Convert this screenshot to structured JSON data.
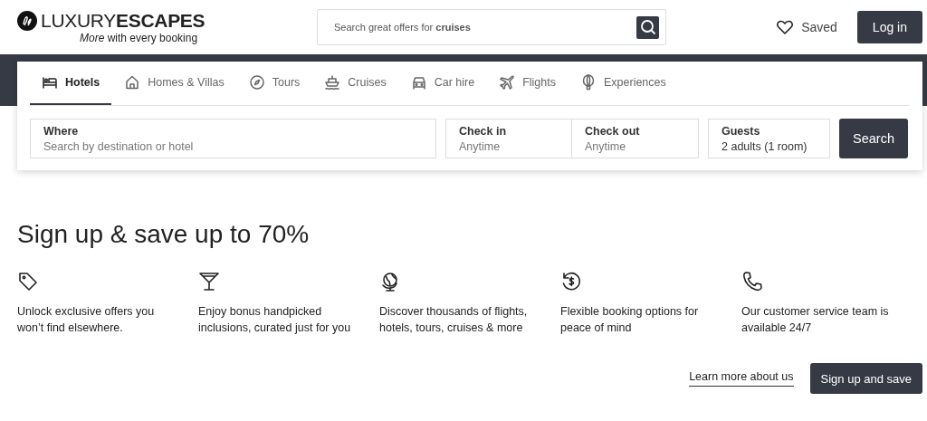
{
  "header": {
    "logo": {
      "brand_light": "LUXURY",
      "brand_bold": "ESCAPES",
      "tagline": "*More* with every booking"
    },
    "search": {
      "hint": "Search great offers for **cruises**"
    },
    "saved": "Saved",
    "login": "Log in"
  },
  "search_panel": {
    "tabs": [
      {
        "label": "Hotels",
        "kind": "bed",
        "selected": true
      },
      {
        "label": "Homes & Villas",
        "kind": "house",
        "selected": false
      },
      {
        "label": "Tours",
        "kind": "compass",
        "selected": false
      },
      {
        "label": "Cruises",
        "kind": "ship",
        "selected": false
      },
      {
        "label": "Car hire",
        "kind": "car",
        "selected": false
      },
      {
        "label": "Flights",
        "kind": "plane",
        "selected": false
      },
      {
        "label": "Experiences",
        "kind": "balloon",
        "selected": false
      }
    ],
    "where": {
      "label": "Where",
      "placeholder": "Search by destination or hotel"
    },
    "check_in": {
      "label": "Check in",
      "placeholder": "Anytime"
    },
    "check_out": {
      "label": "Check out",
      "placeholder": "Anytime"
    },
    "guests": {
      "label": "Guests",
      "value": "2 adults (1 room)"
    },
    "search_button": "Search"
  },
  "signup": {
    "heading": "Sign up & save up to 70%",
    "benefits": [
      {
        "kind": "tag",
        "text": "Unlock exclusive offers you won’t find elsewhere."
      },
      {
        "kind": "cocktail",
        "text": "Enjoy bonus handpicked inclusions, curated just for you"
      },
      {
        "kind": "globe",
        "text": "Discover thousands of flights, hotels, tours, cruises & more"
      },
      {
        "kind": "refund",
        "text": "Flexible booking options for peace of mind"
      },
      {
        "kind": "phone",
        "text": "Our customer service team is available 24/7"
      }
    ],
    "learn_more": "Learn more about us",
    "signup_button": "Sign up and save"
  }
}
